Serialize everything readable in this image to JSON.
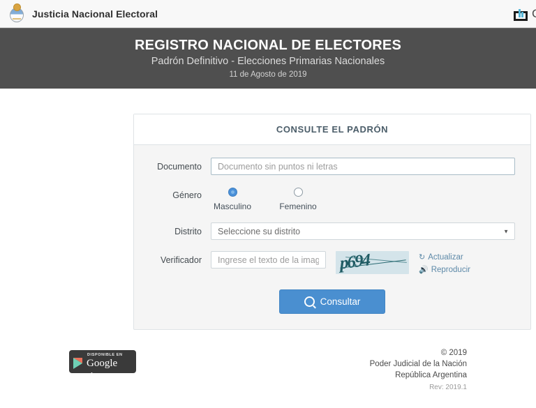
{
  "topbar": {
    "brand_title": "Justicia Nacional Electoral",
    "coat_icon": "argentina-coat-of-arms-icon",
    "share_icon": "share-export-icon",
    "cut_glyph": "C"
  },
  "hero": {
    "title": "REGISTRO NACIONAL DE ELECTORES",
    "subtitle": "Padrón Definitivo - Elecciones Primarias Nacionales",
    "date": "11 de Agosto de 2019"
  },
  "card": {
    "header": "CONSULTE EL PADRÓN",
    "fields": {
      "documento": {
        "label": "Documento",
        "placeholder": "Documento sin puntos ni letras",
        "value": ""
      },
      "genero": {
        "label": "Género",
        "options": [
          {
            "label": "Masculino",
            "selected": true
          },
          {
            "label": "Femenino",
            "selected": false
          }
        ]
      },
      "distrito": {
        "label": "Distrito",
        "selected": "Seleccione su distrito",
        "caret_icon": "chevron-down-icon"
      },
      "verificador": {
        "label": "Verificador",
        "placeholder": "Ingrese el texto de la imagen",
        "value": "",
        "captcha_text": "p694",
        "refresh_label": "Actualizar",
        "refresh_icon": "refresh-icon",
        "play_label": "Reproducir",
        "play_icon": "speaker-icon"
      }
    },
    "submit": {
      "label": "Consultar",
      "icon": "search-icon"
    }
  },
  "footer": {
    "google_play": {
      "small_text": "DISPONIBLE EN",
      "brand_google": "Google",
      "brand_play": "play",
      "icon": "google-play-triangle-icon"
    },
    "copyright": "© 2019",
    "org_line1": "Poder Judicial de la Nación",
    "org_line2": "República Argentina",
    "revision": "Rev: 2019.1"
  },
  "colors": {
    "hero_bg": "#4f4f4f",
    "accent_blue": "#4a8fd0",
    "card_bg": "#f5f5f5",
    "link_blue": "#5d89a8",
    "captcha_bg": "#d4e4ea",
    "captcha_fg": "#1f5b63"
  }
}
